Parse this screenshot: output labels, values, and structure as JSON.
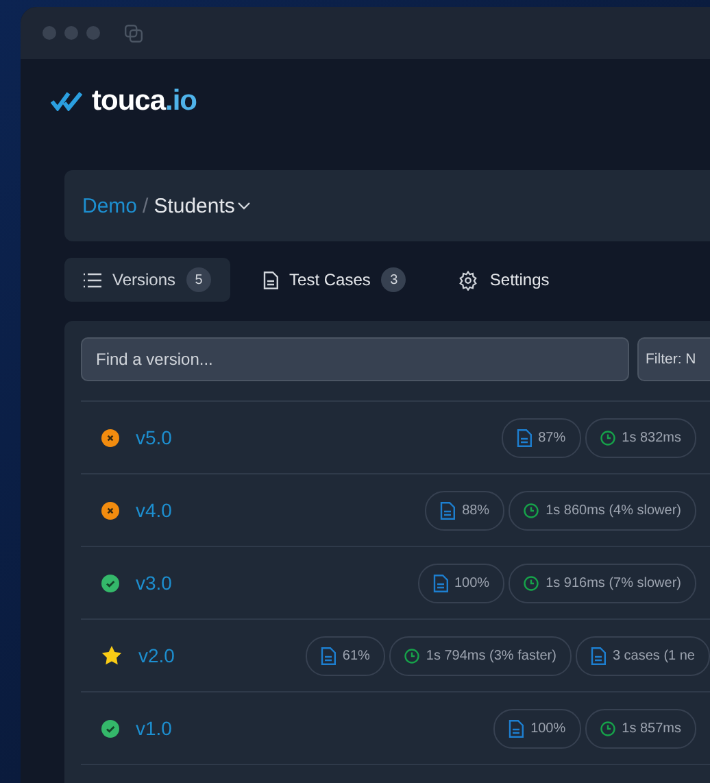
{
  "logo": {
    "name": "touca",
    "suffix": ".io"
  },
  "breadcrumb": {
    "team": "Demo",
    "separator": "/",
    "suite": "Students"
  },
  "tabs": [
    {
      "kind": "list",
      "label": "Versions",
      "count": "5",
      "selected": true
    },
    {
      "kind": "doc",
      "label": "Test Cases",
      "count": "3",
      "selected": false
    },
    {
      "kind": "gear",
      "label": "Settings",
      "selected": false
    }
  ],
  "search": {
    "placeholder": "Find a version..."
  },
  "filter": {
    "label": "Filter: N"
  },
  "versions": [
    {
      "name": "v5.0",
      "kind": "failed",
      "coverage": "87%",
      "time": "1s 832ms"
    },
    {
      "name": "v4.0",
      "kind": "failed",
      "coverage": "88%",
      "time": "1s 860ms (4% slower)"
    },
    {
      "name": "v3.0",
      "kind": "passed",
      "coverage": "100%",
      "time": "1s 916ms (7% slower)"
    },
    {
      "name": "v2.0",
      "kind": "baseline",
      "coverage": "61%",
      "time": "1s 794ms (3% faster)",
      "cases": "3 cases (1 ne"
    },
    {
      "name": "v1.0",
      "kind": "passed",
      "coverage": "100%",
      "time": "1s 857ms"
    }
  ]
}
